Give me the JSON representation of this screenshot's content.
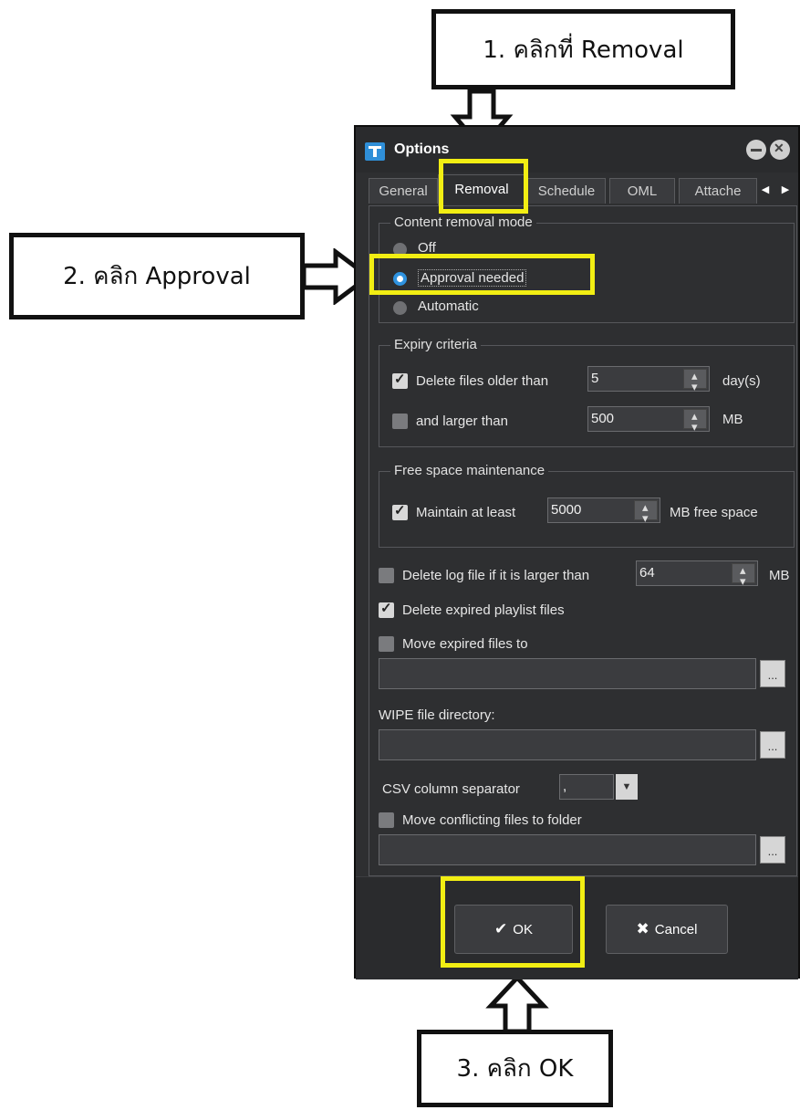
{
  "callouts": {
    "step1": "1. คลิกที่ Removal",
    "step2": "2. คลิก Approval",
    "step3": "3. คลิก OK"
  },
  "dialog": {
    "title": "Options",
    "tabs": [
      "General",
      "Removal",
      "Schedule",
      "OML",
      "Attache"
    ],
    "active_tab": "Removal",
    "content_removal": {
      "title": "Content removal mode",
      "options": [
        "Off",
        "Approval needed",
        "Automatic"
      ],
      "selected": "Approval needed"
    },
    "expiry": {
      "title": "Expiry criteria",
      "older_label": "Delete files older than",
      "older_value": "5",
      "older_unit": "day(s)",
      "older_checked": true,
      "larger_label": "and larger than",
      "larger_value": "500",
      "larger_unit": "MB",
      "larger_checked": false
    },
    "free_space": {
      "title": "Free space maintenance",
      "label": "Maintain at least",
      "value": "5000",
      "unit": "MB free space",
      "checked": true
    },
    "log_file": {
      "label": "Delete log file if it is larger than",
      "value": "64",
      "unit": "MB",
      "checked": false
    },
    "expired_playlist": {
      "label": "Delete expired playlist files",
      "checked": true
    },
    "move_expired": {
      "label": "Move expired files to",
      "checked": false,
      "path": ""
    },
    "wipe": {
      "label": "WIPE file directory:",
      "path": ""
    },
    "csv": {
      "label": "CSV column separator",
      "value": ","
    },
    "move_conflicting": {
      "label": "Move conflicting files to folder",
      "checked": false,
      "path": ""
    },
    "browse_label": "...",
    "ok_label": "OK",
    "cancel_label": "Cancel"
  },
  "colors": {
    "highlight": "#f2ee13",
    "dialog_bg": "#2e2f31",
    "accent": "#2f93e0"
  },
  "icons": [
    "check-icon",
    "x-icon",
    "app-icon",
    "down-arrow-icon",
    "right-arrow-icon",
    "up-arrow-icon"
  ]
}
